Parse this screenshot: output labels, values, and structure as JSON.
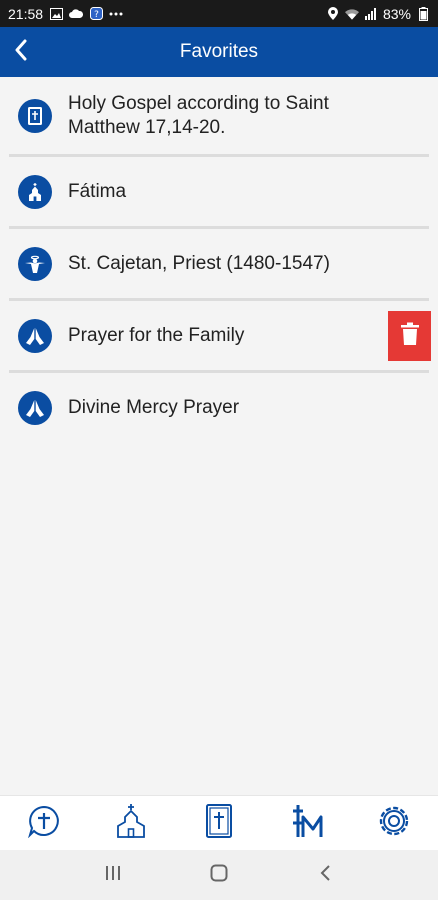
{
  "status_bar": {
    "time": "21:58",
    "battery": "83%",
    "left_icons": [
      "image-icon",
      "cloud-icon",
      "app-icon",
      "more-dots-icon"
    ],
    "right_icons": [
      "location-icon",
      "wifi-icon",
      "signal-icon",
      "battery-icon"
    ]
  },
  "header": {
    "title": "Favorites",
    "back_icon": "chevron-left-icon"
  },
  "favorites": [
    {
      "label": "Holy Gospel according to Saint Matthew 17,14-20.",
      "icon": "bible-icon"
    },
    {
      "label": "Fátima",
      "icon": "church-icon"
    },
    {
      "label": "St. Cajetan, Priest (1480-1547)",
      "icon": "saint-icon"
    },
    {
      "label": "Prayer for the Family",
      "icon": "praying-hands-icon",
      "swiped": true
    },
    {
      "label": "Divine Mercy Prayer",
      "icon": "praying-hands-icon"
    }
  ],
  "delete_action": {
    "icon": "trash-icon"
  },
  "bottom_nav": [
    {
      "icon": "cross-bubble-icon"
    },
    {
      "icon": "church-icon"
    },
    {
      "icon": "bible-icon"
    },
    {
      "icon": "jesus-monogram-icon",
      "active": true
    },
    {
      "icon": "settings-icon"
    }
  ],
  "system_nav": [
    {
      "icon": "recents-icon"
    },
    {
      "icon": "home-icon"
    },
    {
      "icon": "back-icon"
    }
  ],
  "colors": {
    "primary": "#0a4da2",
    "delete": "#e53935",
    "background": "#f4f4f4",
    "status_bar": "#1a1a1a"
  }
}
